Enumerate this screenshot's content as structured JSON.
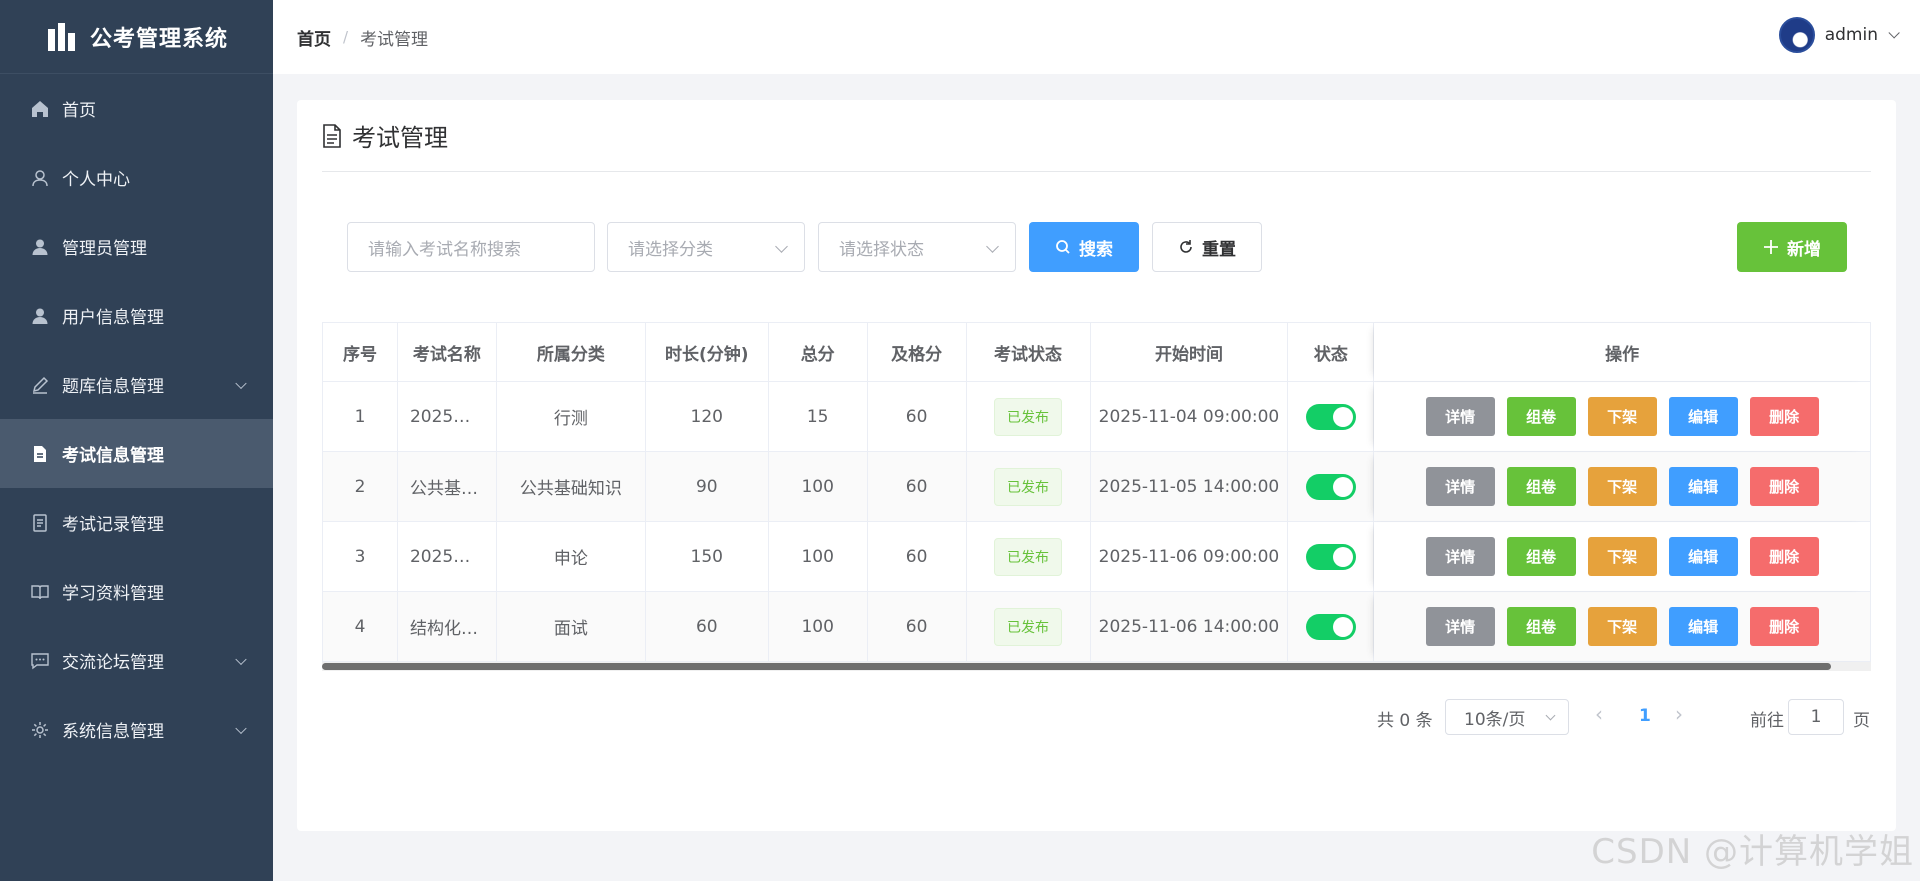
{
  "app": {
    "title": "公考管理系统"
  },
  "sidebar": {
    "items": [
      {
        "label": "首页",
        "icon": "home-icon",
        "active": false,
        "has_children": false
      },
      {
        "label": "个人中心",
        "icon": "user-outline-icon",
        "active": false,
        "has_children": false
      },
      {
        "label": "管理员管理",
        "icon": "user-icon",
        "active": false,
        "has_children": false
      },
      {
        "label": "用户信息管理",
        "icon": "user-icon",
        "active": false,
        "has_children": false
      },
      {
        "label": "题库信息管理",
        "icon": "pen-icon",
        "active": false,
        "has_children": true
      },
      {
        "label": "考试信息管理",
        "icon": "document-icon",
        "active": true,
        "has_children": false
      },
      {
        "label": "考试记录管理",
        "icon": "list-doc-icon",
        "active": false,
        "has_children": false
      },
      {
        "label": "学习资料管理",
        "icon": "book-icon",
        "active": false,
        "has_children": false
      },
      {
        "label": "交流论坛管理",
        "icon": "chat-icon",
        "active": false,
        "has_children": true
      },
      {
        "label": "系统信息管理",
        "icon": "gear-icon",
        "active": false,
        "has_children": true
      }
    ]
  },
  "header": {
    "breadcrumb_home": "首页",
    "breadcrumb_sep": "/",
    "breadcrumb_current": "考试管理",
    "user_name": "admin"
  },
  "page": {
    "title": "考试管理"
  },
  "filters": {
    "name_placeholder": "请输入考试名称搜索",
    "category_placeholder": "请选择分类",
    "status_placeholder": "请选择状态",
    "search_label": "搜索",
    "reset_label": "重置",
    "add_label": "新增"
  },
  "table": {
    "columns": [
      "序号",
      "考试名称",
      "所属分类",
      "时长(分钟)",
      "总分",
      "及格分",
      "考试状态",
      "开始时间",
      "状态",
      "操作"
    ],
    "rows": [
      {
        "index": "1",
        "name": "2025…",
        "category": "行测",
        "duration": "120",
        "total": "15",
        "pass": "60",
        "exam_status": "已发布",
        "start": "2025-11-04 09:00:00",
        "enabled": true
      },
      {
        "index": "2",
        "name": "公共基…",
        "category": "公共基础知识",
        "duration": "90",
        "total": "100",
        "pass": "60",
        "exam_status": "已发布",
        "start": "2025-11-05 14:00:00",
        "enabled": true
      },
      {
        "index": "3",
        "name": "2025…",
        "category": "申论",
        "duration": "150",
        "total": "100",
        "pass": "60",
        "exam_status": "已发布",
        "start": "2025-11-06 09:00:00",
        "enabled": true
      },
      {
        "index": "4",
        "name": "结构化…",
        "category": "面试",
        "duration": "60",
        "total": "100",
        "pass": "60",
        "exam_status": "已发布",
        "start": "2025-11-06 14:00:00",
        "enabled": true
      }
    ],
    "actions": {
      "detail": "详情",
      "compose": "组卷",
      "off_shelf": "下架",
      "edit": "编辑",
      "delete": "删除"
    }
  },
  "pagination": {
    "total_text": "共 0 条",
    "page_size": "10条/页",
    "current_page": "1",
    "jump_prefix": "前往",
    "jump_value": "1",
    "jump_suffix": "页"
  },
  "watermark": "CSDN @计算机学姐",
  "colors": {
    "sidebar_bg": "#304156",
    "primary": "#409eff",
    "success": "#67c23a",
    "warning": "#e6a23c",
    "danger": "#f56c6c",
    "info": "#909399",
    "switch_on": "#13ce66"
  }
}
